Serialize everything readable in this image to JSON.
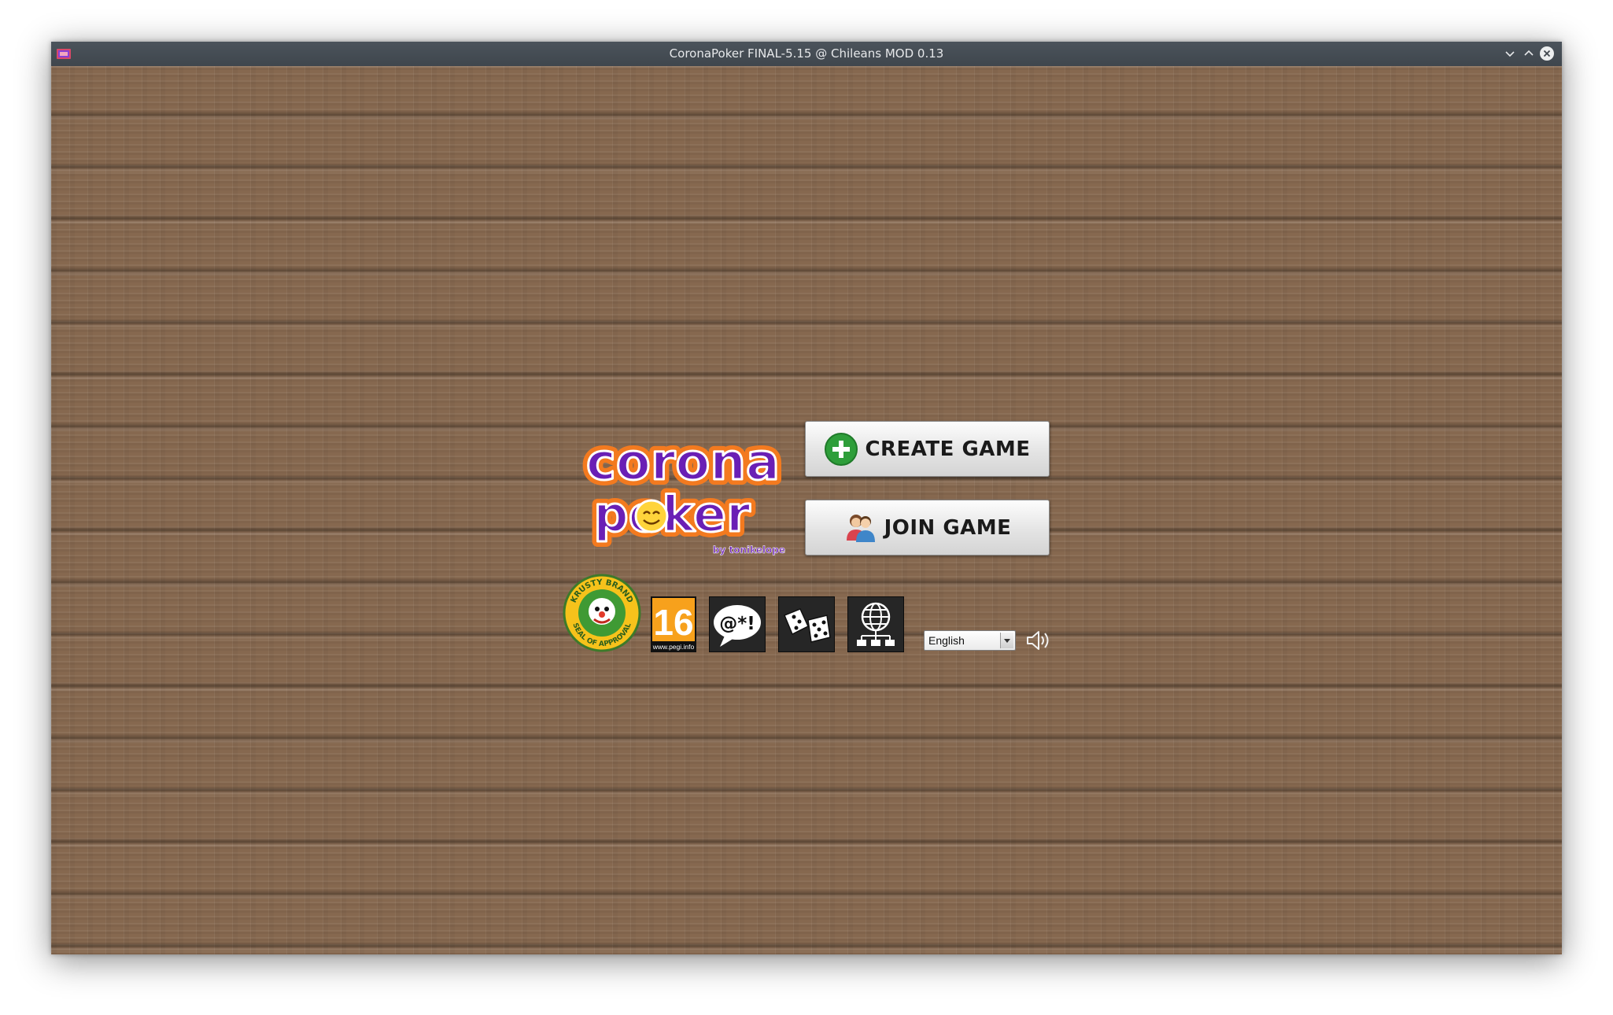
{
  "window": {
    "title": "CoronaPoker FINAL-5.15 @ Chileans MOD 0.13"
  },
  "logo": {
    "line1": "corona",
    "line2": "poker",
    "byline": "by tonikelope"
  },
  "menu": {
    "create_label": "CREATE GAME",
    "join_label": "JOIN GAME"
  },
  "badges": {
    "krusty_top": "KRUSTY BRAND",
    "krusty_bottom": "SEAL OF APPROVAL",
    "pegi_age": "16",
    "pegi_site": "www.pegi.info",
    "language_symbol": "@*!"
  },
  "controls": {
    "language": "English"
  },
  "colors": {
    "wood": "#86684f",
    "create_icon": "#2e9e3a",
    "logo_purple": "#6a1fb5",
    "logo_orange": "#f37a1f",
    "pegi_orange": "#f7a11c"
  }
}
